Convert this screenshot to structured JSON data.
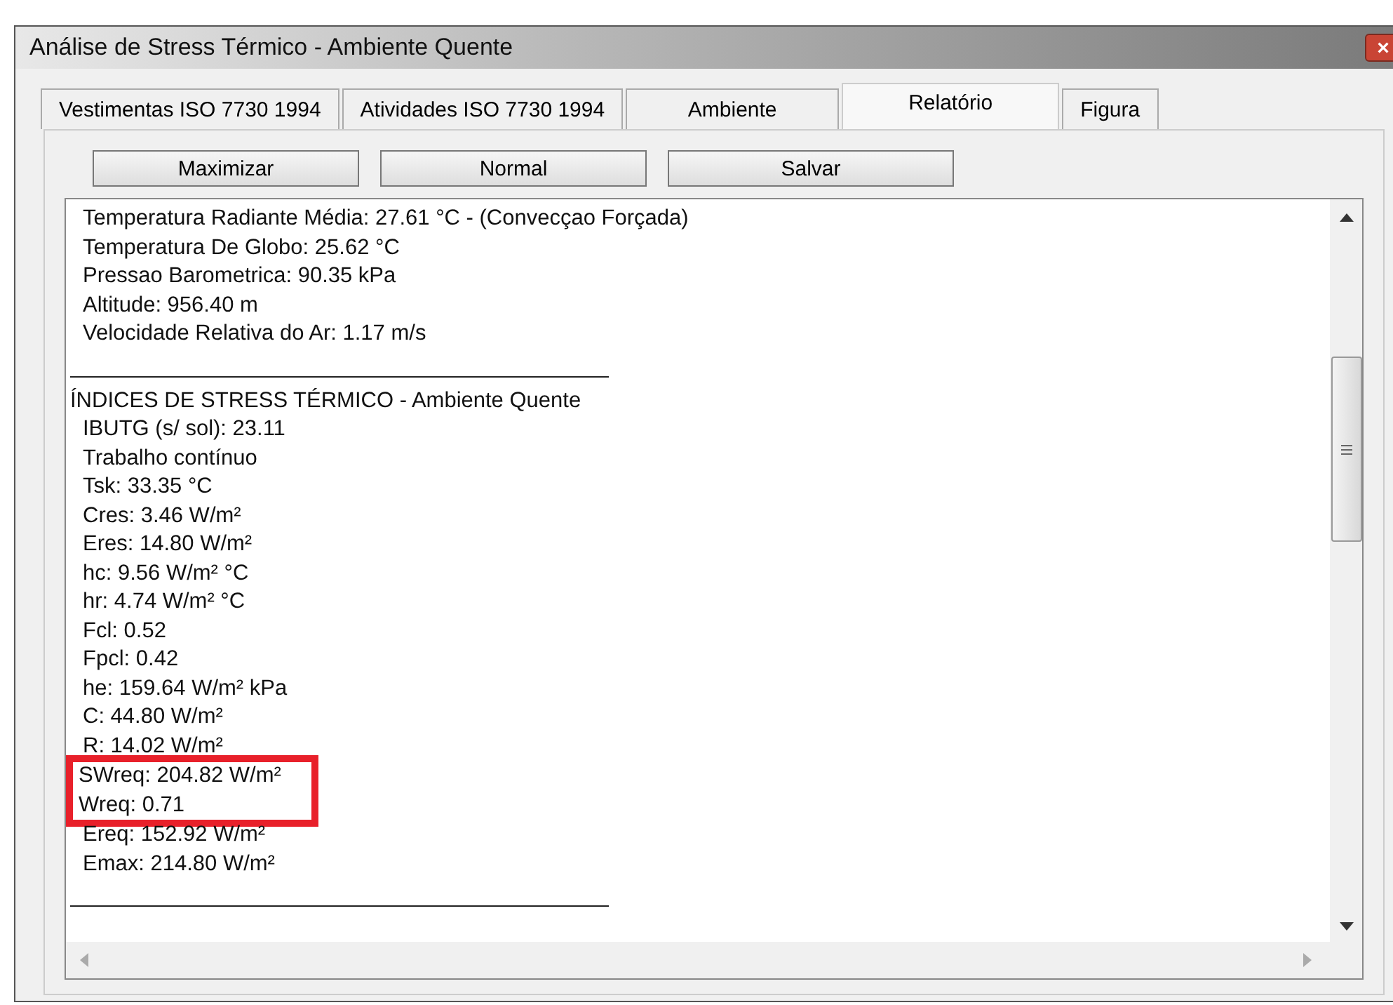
{
  "window": {
    "title": "Análise de Stress Térmico - Ambiente Quente",
    "close": "×"
  },
  "tabs": [
    {
      "label": "Vestimentas ISO 7730 1994",
      "selected": false
    },
    {
      "label": "Atividades ISO 7730 1994",
      "selected": false
    },
    {
      "label": "Ambiente",
      "selected": false
    },
    {
      "label": "Relatório",
      "selected": true
    },
    {
      "label": "Figura",
      "selected": false
    }
  ],
  "buttons": [
    "Maximizar",
    "Normal",
    "Salvar"
  ],
  "report": [
    {
      "kind": "line",
      "text": "Temperatura Radiante Média: 27.61 °C - (Convecçao Forçada)",
      "highlighted": false
    },
    {
      "kind": "line",
      "text": "Temperatura De Globo: 25.62 °C",
      "highlighted": false
    },
    {
      "kind": "line",
      "text": "Pressao Barometrica: 90.35 kPa",
      "highlighted": false
    },
    {
      "kind": "line",
      "text": "Altitude: 956.40 m",
      "highlighted": false
    },
    {
      "kind": "line",
      "text": "Velocidade Relativa do Ar: 1.17 m/s",
      "highlighted": false
    },
    {
      "kind": "rule"
    },
    {
      "kind": "heading",
      "text": "ÍNDICES DE STRESS TÉRMICO - Ambiente Quente",
      "highlighted": false
    },
    {
      "kind": "line",
      "text": "IBUTG (s/ sol): 23.11",
      "highlighted": false
    },
    {
      "kind": "line",
      "text": "Trabalho contínuo",
      "highlighted": false
    },
    {
      "kind": "line",
      "text": "Tsk: 33.35 °C",
      "highlighted": false
    },
    {
      "kind": "line",
      "text": "Cres: 3.46 W/m²",
      "highlighted": false
    },
    {
      "kind": "line",
      "text": "Eres: 14.80 W/m²",
      "highlighted": false
    },
    {
      "kind": "line",
      "text": "hc: 9.56 W/m² °C",
      "highlighted": false
    },
    {
      "kind": "line",
      "text": "hr: 4.74 W/m² °C",
      "highlighted": false
    },
    {
      "kind": "line",
      "text": "Fcl: 0.52",
      "highlighted": false
    },
    {
      "kind": "line",
      "text": "Fpcl: 0.42",
      "highlighted": false
    },
    {
      "kind": "line",
      "text": "he: 159.64 W/m² kPa",
      "highlighted": false
    },
    {
      "kind": "line",
      "text": "C: 44.80 W/m²",
      "highlighted": false
    },
    {
      "kind": "line",
      "text": "R: 14.02 W/m²",
      "highlighted": false
    },
    {
      "kind": "line",
      "text": "SWreq: 204.82 W/m²",
      "highlighted": true
    },
    {
      "kind": "line",
      "text": "Wreq: 0.71",
      "highlighted": true
    },
    {
      "kind": "line",
      "text": "Ereq: 152.92 W/m²",
      "highlighted": false
    },
    {
      "kind": "line",
      "text": "Emax: 214.80 W/m²",
      "highlighted": false
    },
    {
      "kind": "rule"
    }
  ]
}
